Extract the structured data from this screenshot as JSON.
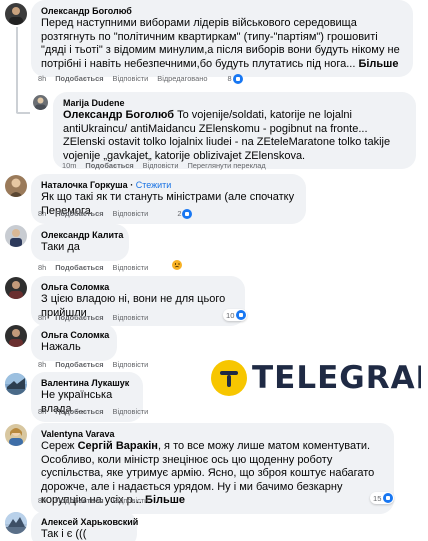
{
  "actions": {
    "like": "Подобається",
    "reply": "Відповісти",
    "edited": "Відредаговано",
    "translate": "Переглянути переклад"
  },
  "comments": [
    {
      "name": "Олександр Боголюб",
      "text": "Перед наступними виборами лідерів військового середовища розтягнуть по \"політичним квартиркам\" (типу-\"партіям\") грошовиті \"дяді і тьоті\" з відомим минулим,а після виборів вони будуть нікому не потрібні і навіть небезпечними,бо будуть плутатись під нога...",
      "more": "Більше",
      "time": "8h",
      "reactions": "8"
    },
    {
      "name": "Marija Dudene",
      "tag": "Олександр Боголюб",
      "text": " To vojenije/soldati, katorije ne lojalni antiUkraincu/ antiMaidancu ZElenskomu - pogibnut na fronte... ZElenski ostavit tolko lojalnix liudei - na ZEteleMaratone tolko takije vojenije „gavkajet„ katorije oblizivajet ZElenskova.",
      "time": "10m"
    },
    {
      "name": "Наталочка Горкуша",
      "follow": "Стежити",
      "text": "Як що такі як ти стануть міністрами (але спочатку Перемога",
      "time": "8h",
      "reactions": "2"
    },
    {
      "name": "Олександр Калита",
      "text": "Таки да",
      "time": "8h"
    },
    {
      "name": "Ольга Соломка",
      "text": "З цією владою ні, вони не для цього прийшли",
      "time": "8h",
      "reactions": "10"
    },
    {
      "name": "Ольга Соломка",
      "text": "Нажаль",
      "time": "8h"
    },
    {
      "name": "Валентина Лукашук",
      "text": "Не українська влада ...",
      "time": "8h"
    },
    {
      "name": "Valentyna Varava",
      "tag": "Сергій Варакін",
      "text_pre": "Сереж ",
      "text": ", я то все можу лише матом коментувати. Особливо, коли міністр знецінює ось цю щоденну роботу суспільства, яке утримує армію. Ясно, що зброя коштує набагато дорожче, але і надається урядом. Ну і ми бачимо безкарну корупцію на усіх р...",
      "more": "Більше",
      "time": "8h",
      "reactions": "15"
    },
    {
      "name": "Алексей Харьковский",
      "text": "Так і є (((",
      "time": "8h"
    }
  ],
  "logo": {
    "text": "TELEGRAF"
  },
  "colors": {
    "bubble": "#f0f2f5",
    "meta": "#65676b",
    "link": "#1877f2",
    "logo_yellow": "#f7c600",
    "logo_dark": "#1f2a44"
  }
}
